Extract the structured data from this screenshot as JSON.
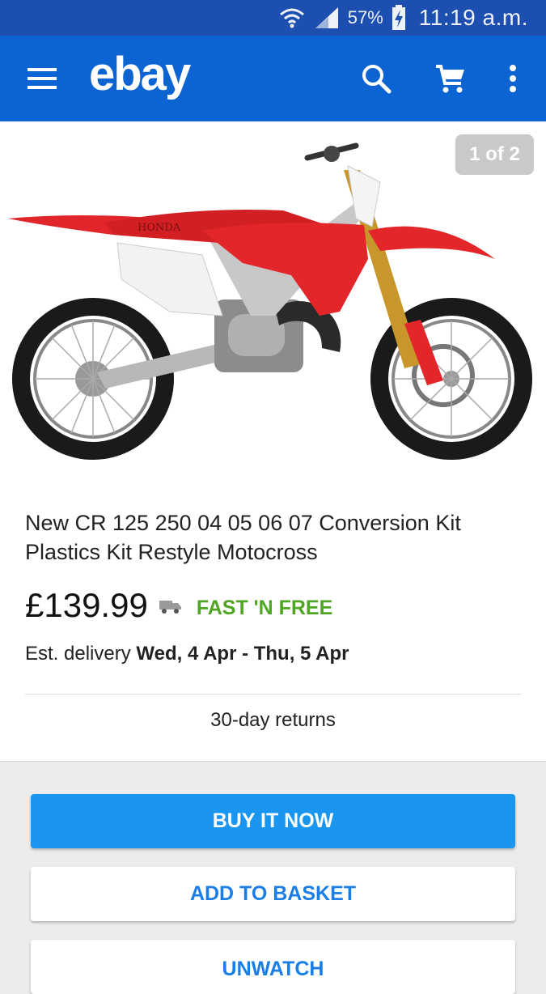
{
  "status_bar": {
    "battery_percent": "57%",
    "time": "11:19 a.m.",
    "icons": [
      "wifi-icon",
      "signal-icon",
      "battery-charging-icon"
    ]
  },
  "app_bar": {
    "logo": "ebay",
    "icons": [
      "menu-icon",
      "search-icon",
      "cart-icon",
      "more-vert-icon"
    ],
    "color": "#0c63d2"
  },
  "item": {
    "image_counter": "1 of 2",
    "title": "New CR 125 250 04 05 06 07 Conversion Kit Plastics Kit Restyle Motocross",
    "price": "£139.99",
    "shipping_label": "FAST 'N FREE",
    "delivery_prefix": "Est. delivery",
    "delivery_dates": "Wed, 4 Apr - Thu, 5 Apr",
    "returns": "30-day returns",
    "bike_brand_text": "HONDA"
  },
  "actions": {
    "buy_now": "BUY IT NOW",
    "add_to_basket": "ADD TO BASKET",
    "unwatch": "UNWATCH"
  },
  "colors": {
    "status_bar": "#1d4fb0",
    "primary_button": "#1a96f0",
    "link_text": "#1a7ee6",
    "free_shipping": "#4fa623"
  }
}
